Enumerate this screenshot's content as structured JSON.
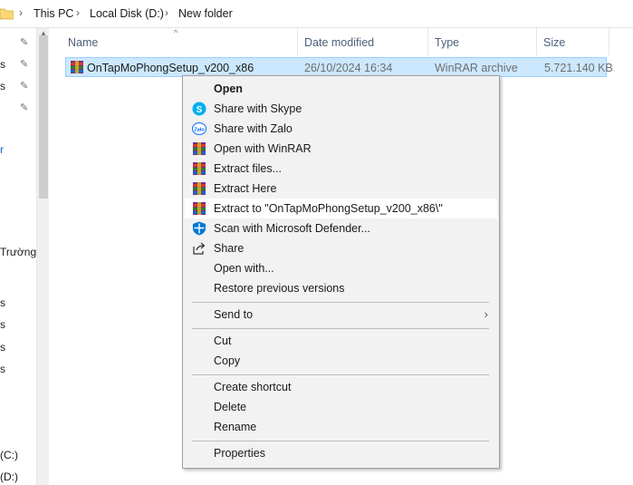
{
  "breadcrumb": {
    "items": [
      "This PC",
      "Local Disk (D:)",
      "New folder"
    ]
  },
  "navpane": {
    "fragments": [
      "s",
      "s",
      "r",
      "Trường",
      "s",
      "s",
      "s",
      "s",
      "(C:)",
      "(D:)"
    ]
  },
  "columns": {
    "name": "Name",
    "date": "Date modified",
    "type": "Type",
    "size": "Size"
  },
  "file": {
    "name": "OnTapMoPhongSetup_v200_x86",
    "date": "26/10/2024 16:34",
    "type": "WinRAR archive",
    "size": "5.721.140 KB"
  },
  "context_menu": {
    "open": "Open",
    "share_skype": "Share with Skype",
    "share_zalo": "Share with Zalo",
    "open_winrar": "Open with WinRAR",
    "extract_files": "Extract files...",
    "extract_here": "Extract Here",
    "extract_to": "Extract to \"OnTapMoPhongSetup_v200_x86\\\"",
    "scan_defender": "Scan with Microsoft Defender...",
    "share": "Share",
    "open_with": "Open with...",
    "restore_versions": "Restore previous versions",
    "send_to": "Send to",
    "cut": "Cut",
    "copy": "Copy",
    "create_shortcut": "Create shortcut",
    "delete": "Delete",
    "rename": "Rename",
    "properties": "Properties",
    "zalo_icon_text": "Zalo"
  },
  "colors": {
    "selection_bg": "#cce8ff",
    "selection_border": "#99d1ff",
    "menu_bg": "#f2f2f2",
    "skype_blue": "#00aff0",
    "defender_blue": "#0078d4"
  }
}
